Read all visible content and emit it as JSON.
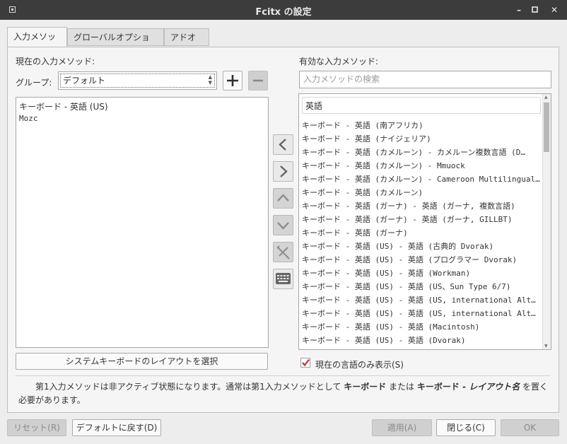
{
  "window": {
    "title": "Fcitx の設定"
  },
  "tabs": [
    {
      "label": "入力メソッド"
    },
    {
      "label": "グローバルオプション"
    },
    {
      "label": "アドオン"
    }
  ],
  "left": {
    "heading": "現在の入力メソッド:",
    "group_label": "グループ:",
    "group_value": "デフォルト",
    "items": [
      "キーボード - 英語 (US)",
      "Mozc"
    ],
    "layout_button": "システムキーボードのレイアウトを選択"
  },
  "right": {
    "heading": "有効な入力メソッド:",
    "search_placeholder": "入力メソッドの検索",
    "language_header": "英語",
    "items": [
      "キーボード - 英語 (南アフリカ)",
      "キーボード - 英語 (ナイジェリア)",
      "キーボード - 英語 (カメルーン) - カメルーン複数言語 (D…",
      "キーボード - 英語 (カメルーン) - Mmuock",
      "キーボード - 英語 (カメルーン) - Cameroon Multilingual…",
      "キーボード - 英語 (カメルーン)",
      "キーボード - 英語 (ガーナ) - 英語 (ガーナ, 複数言語)",
      "キーボード - 英語 (ガーナ) - 英語 (ガーナ, GILLBT)",
      "キーボード - 英語 (ガーナ)",
      "キーボード - 英語 (US) - 英語 (古典的 Dvorak)",
      "キーボード - 英語 (US) - 英語 (プログラマー Dvorak)",
      "キーボード - 英語 (US) - 英語 (Workman)",
      "キーボード - 英語 (US) - 英語 (US、Sun Type 6/7)",
      "キーボード - 英語 (US) - 英語 (US, international AltGr…",
      "キーボード - 英語 (US) - 英語 (US, international AltGr…",
      "キーボード - 英語 (US) - 英語 (Macintosh)",
      "キーボード - 英語 (US) - 英語 (Dvorak)"
    ],
    "checkbox_label": "現在の言語のみ表示(S)",
    "checkbox_checked": true
  },
  "info": {
    "before": "第1入力メソッドは非アクティブ状態になります。通常は第1入力メソッドとして ",
    "kb1": "キーボード",
    "mid": " または ",
    "kb2": "キーボード - ",
    "kb2i": "レイアウト名",
    "after": " を置く必要があります。"
  },
  "footer": {
    "reset": "リセット(R)",
    "default": "デフォルトに戻す(D)",
    "apply": "適用(A)",
    "close": "閉じる(C)",
    "ok": "OK"
  },
  "colors": {
    "accent": "#c03030",
    "titlebar": "#3c3c3c"
  }
}
